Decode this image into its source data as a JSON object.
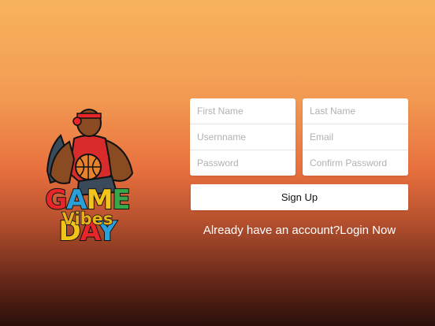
{
  "logo": {
    "title": "GAME DAY",
    "subtitle": "Vibes",
    "title_colors": [
      "#e7262a",
      "#2a9fd8",
      "#f2c319",
      "#37a84a",
      "#f2c319",
      "#e7262a",
      "#2a9fd8"
    ],
    "mascot_icon": "basketball-player-icon"
  },
  "form": {
    "left_fields": [
      {
        "placeholder": "First Name"
      },
      {
        "placeholder": "Usernname"
      },
      {
        "placeholder": "Password"
      }
    ],
    "right_fields": [
      {
        "placeholder": "Last Name"
      },
      {
        "placeholder": "Email"
      },
      {
        "placeholder": "Confirm Password"
      }
    ],
    "signup_label": "Sign Up"
  },
  "footer": {
    "prompt": "Already have an account?",
    "login_label": "Login Now"
  }
}
